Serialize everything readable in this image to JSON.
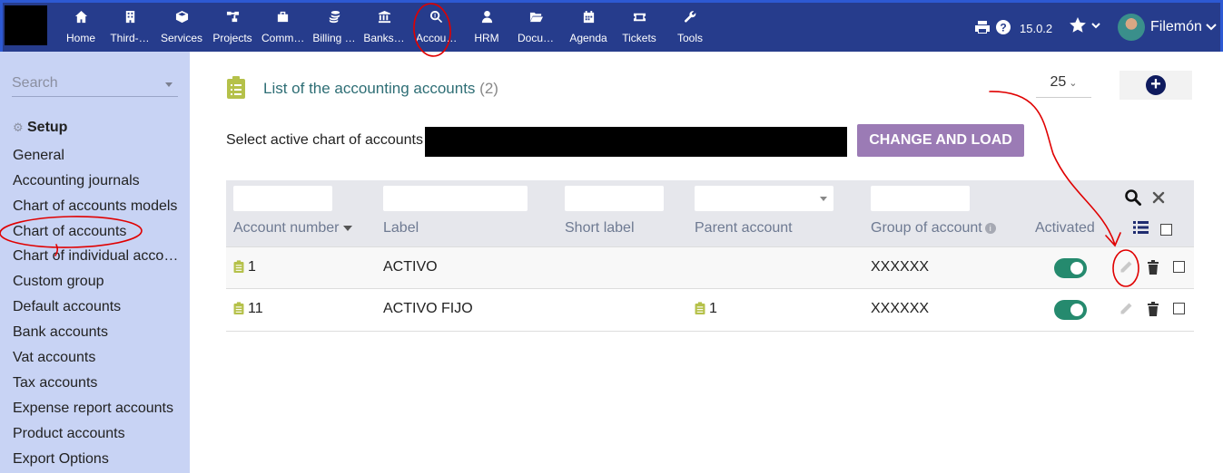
{
  "topbar": {
    "nav": [
      {
        "label": "Home",
        "icon": "home-icon"
      },
      {
        "label": "Third-…",
        "icon": "building-icon"
      },
      {
        "label": "Services",
        "icon": "cube-icon"
      },
      {
        "label": "Projects",
        "icon": "sitemap-icon"
      },
      {
        "label": "Comm…",
        "icon": "briefcase-icon"
      },
      {
        "label": "Billing …",
        "icon": "coins-icon"
      },
      {
        "label": "Banks…",
        "icon": "bank-icon"
      },
      {
        "label": "Accou…",
        "icon": "search-dollar-icon"
      },
      {
        "label": "HRM",
        "icon": "user-tie-icon"
      },
      {
        "label": "Docu…",
        "icon": "folder-open-icon"
      },
      {
        "label": "Agenda",
        "icon": "calendar-icon"
      },
      {
        "label": "Tickets",
        "icon": "ticket-icon"
      },
      {
        "label": "Tools",
        "icon": "wrench-icon"
      }
    ],
    "version": "15.0.2",
    "username": "Filemón"
  },
  "sidebar": {
    "search_placeholder": "Search",
    "section_title": "Setup",
    "items": [
      "General",
      "Accounting journals",
      "Chart of accounts models",
      "Chart of accounts",
      "Chart of individual acco…",
      "Custom group",
      "Default accounts",
      "Bank accounts",
      "Vat accounts",
      "Tax accounts",
      "Expense report accounts",
      "Product accounts",
      "Export Options"
    ]
  },
  "main": {
    "title": "List of the accounting accounts",
    "count": "(2)",
    "limit": "25",
    "select_label": "Select active chart of accounts :",
    "change_button": "CHANGE AND LOAD",
    "columns": {
      "account_number": "Account number",
      "label": "Label",
      "short_label": "Short label",
      "parent_account": "Parent account",
      "group_of_account": "Group of account",
      "activated": "Activated"
    },
    "rows": [
      {
        "account_number": "1",
        "label": "ACTIVO",
        "short_label": "",
        "parent_account": "",
        "group": "XXXXXX",
        "activated": true
      },
      {
        "account_number": "11",
        "label": "ACTIVO FIJO",
        "short_label": "",
        "parent_account": "1",
        "group": "XXXXXX",
        "activated": true
      }
    ]
  },
  "colors": {
    "topbar_bg": "#263c8c",
    "sidebar_bg": "#c8d3f4",
    "change_button_bg": "#9b7bb5",
    "toggle_on": "#258a6e",
    "annotation_red": "#e00000"
  }
}
